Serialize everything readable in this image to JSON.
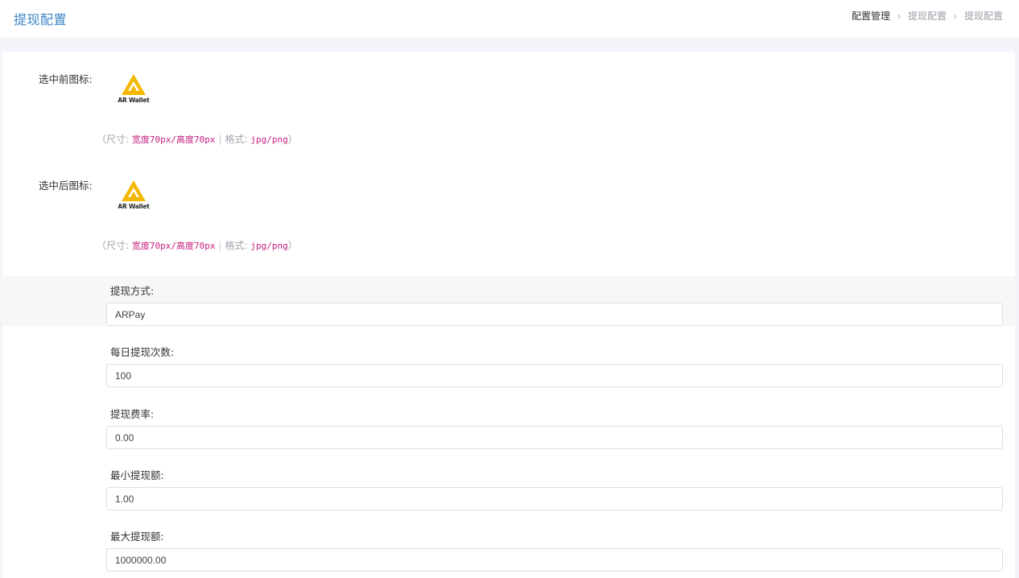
{
  "header": {
    "title": "提现配置",
    "breadcrumb": [
      "配置管理",
      "提现配置",
      "提现配置"
    ]
  },
  "icons": [
    {
      "label": "选中前图标:",
      "logo_text": "AR Wallet",
      "hint": {
        "open": "（尺寸:",
        "size": "宽度70px/高度70px",
        "format_label": "格式:",
        "format": "jpg/png",
        "close": "）"
      }
    },
    {
      "label": "选中后图标:",
      "logo_text": "AR Wallet",
      "hint": {
        "open": "（尺寸:",
        "size": "宽度70px/高度70px",
        "format_label": "格式:",
        "format": "jpg/png",
        "close": "）"
      }
    }
  ],
  "fields": [
    {
      "label": "提现方式:",
      "value": "ARPay"
    },
    {
      "label": "每日提现次数:",
      "value": "100"
    },
    {
      "label": "提现费率:",
      "value": "0.00"
    },
    {
      "label": "最小提现额:",
      "value": "1.00"
    },
    {
      "label": "最大提现额:",
      "value": "1000000.00"
    }
  ],
  "colors": {
    "accent": "#3b86c6",
    "logo_yellow": "#f5b800",
    "code_pink": "#c41d7f"
  }
}
